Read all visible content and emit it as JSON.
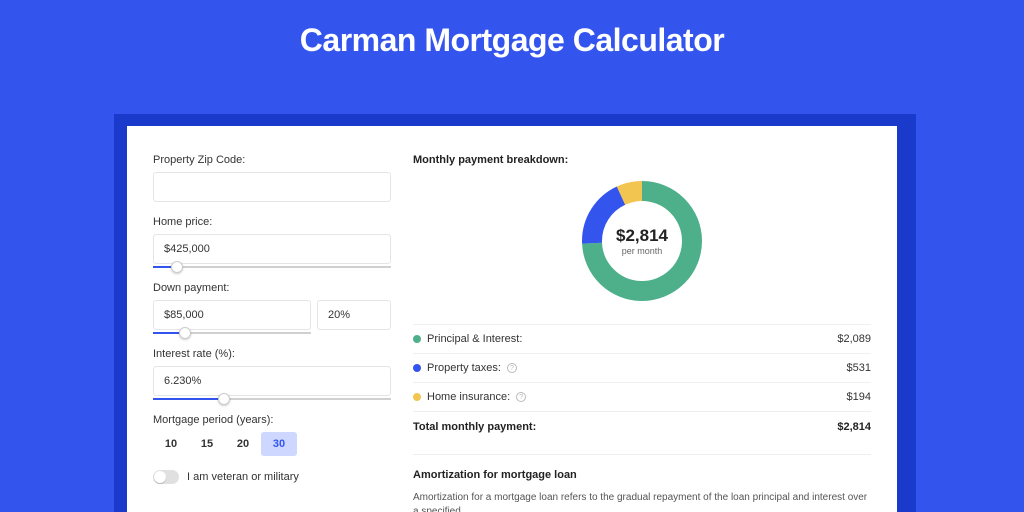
{
  "title": "Carman Mortgage Calculator",
  "form": {
    "zip_label": "Property Zip Code:",
    "zip_value": "",
    "home_price_label": "Home price:",
    "home_price_value": "$425,000",
    "down_payment_label": "Down payment:",
    "down_payment_amount": "$85,000",
    "down_payment_pct": "20%",
    "interest_label": "Interest rate (%):",
    "interest_value": "6.230%",
    "period_label": "Mortgage period (years):",
    "periods": [
      "10",
      "15",
      "20",
      "30"
    ],
    "period_active": "30",
    "veteran_label": "I am veteran or military"
  },
  "breakdown": {
    "title": "Monthly payment breakdown:",
    "center_amount": "$2,814",
    "center_sub": "per month",
    "rows": [
      {
        "label": "Principal & Interest:",
        "value": "$2,089",
        "color": "#4db08a",
        "info": false
      },
      {
        "label": "Property taxes:",
        "value": "$531",
        "color": "#3355ee",
        "info": true
      },
      {
        "label": "Home insurance:",
        "value": "$194",
        "color": "#f1c550",
        "info": true
      }
    ],
    "total_label": "Total monthly payment:",
    "total_value": "$2,814"
  },
  "amortization": {
    "title": "Amortization for mortgage loan",
    "text": "Amortization for a mortgage loan refers to the gradual repayment of the loan principal and interest over a specified"
  },
  "chart_data": {
    "type": "pie",
    "title": "Monthly payment breakdown",
    "series": [
      {
        "name": "Principal & Interest",
        "value": 2089,
        "color": "#4db08a"
      },
      {
        "name": "Property taxes",
        "value": 531,
        "color": "#3355ee"
      },
      {
        "name": "Home insurance",
        "value": 194,
        "color": "#f1c550"
      }
    ],
    "total": 2814,
    "unit": "USD per month"
  }
}
